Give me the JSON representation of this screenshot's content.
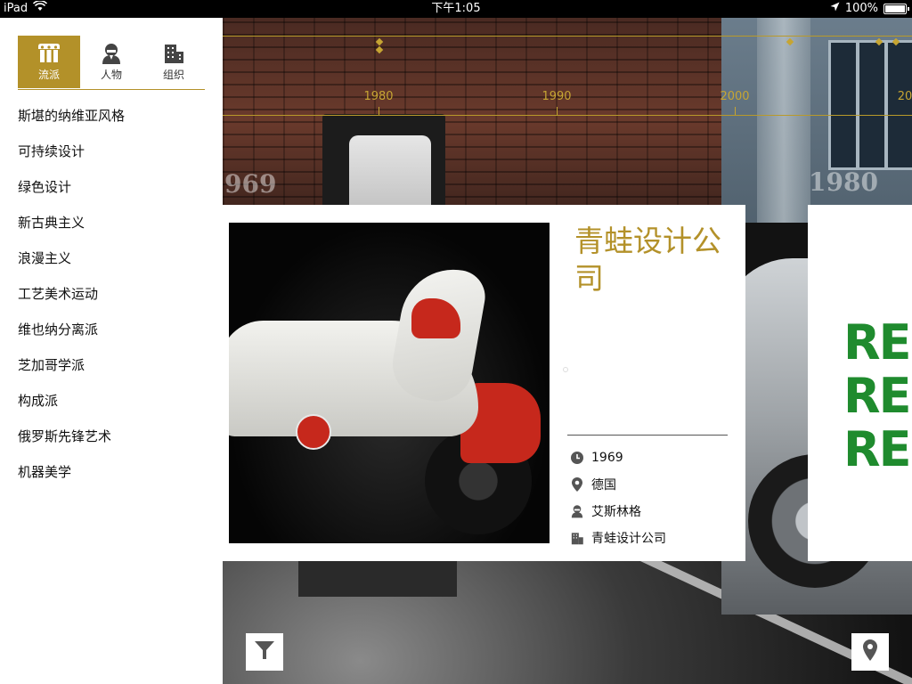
{
  "status_bar": {
    "device": "iPad",
    "time": "下午1:05",
    "battery": "100%",
    "icons": [
      "wifi-icon",
      "location-arrow-icon",
      "battery-icon"
    ]
  },
  "sidebar": {
    "tabs": [
      {
        "label": "流派",
        "icon": "columns-icon",
        "active": true
      },
      {
        "label": "人物",
        "icon": "person-icon",
        "active": false
      },
      {
        "label": "组织",
        "icon": "building-icon",
        "active": false
      }
    ],
    "items": [
      {
        "label": "斯堪的纳维亚风格"
      },
      {
        "label": "可持续设计"
      },
      {
        "label": "绿色设计"
      },
      {
        "label": "新古典主义"
      },
      {
        "label": "浪漫主义"
      },
      {
        "label": "工艺美术运动"
      },
      {
        "label": "维也纳分离派"
      },
      {
        "label": "芝加哥学派"
      },
      {
        "label": "构成派"
      },
      {
        "label": "俄罗斯先锋艺术"
      },
      {
        "label": "机器美学"
      }
    ]
  },
  "timeline": {
    "years": [
      "1980",
      "1990",
      "2000",
      "20"
    ]
  },
  "background_years": [
    "969",
    "1980"
  ],
  "card": {
    "title": "青蛙设计公司",
    "photo_icon": "yamaha-motorcycle-photo",
    "meta": {
      "year": "1969",
      "location": "德国",
      "person": "艾斯林格",
      "organization": "青蛙设计公司"
    }
  },
  "next_card": {
    "lines": [
      "RE",
      "RE",
      "RE"
    ]
  },
  "buttons": {
    "filter_icon": "filter-icon",
    "map_icon": "map-pin-icon"
  },
  "colors": {
    "accent": "#b39129",
    "timeline": "#c6a533",
    "next_card_text": "#1f8b2e"
  }
}
